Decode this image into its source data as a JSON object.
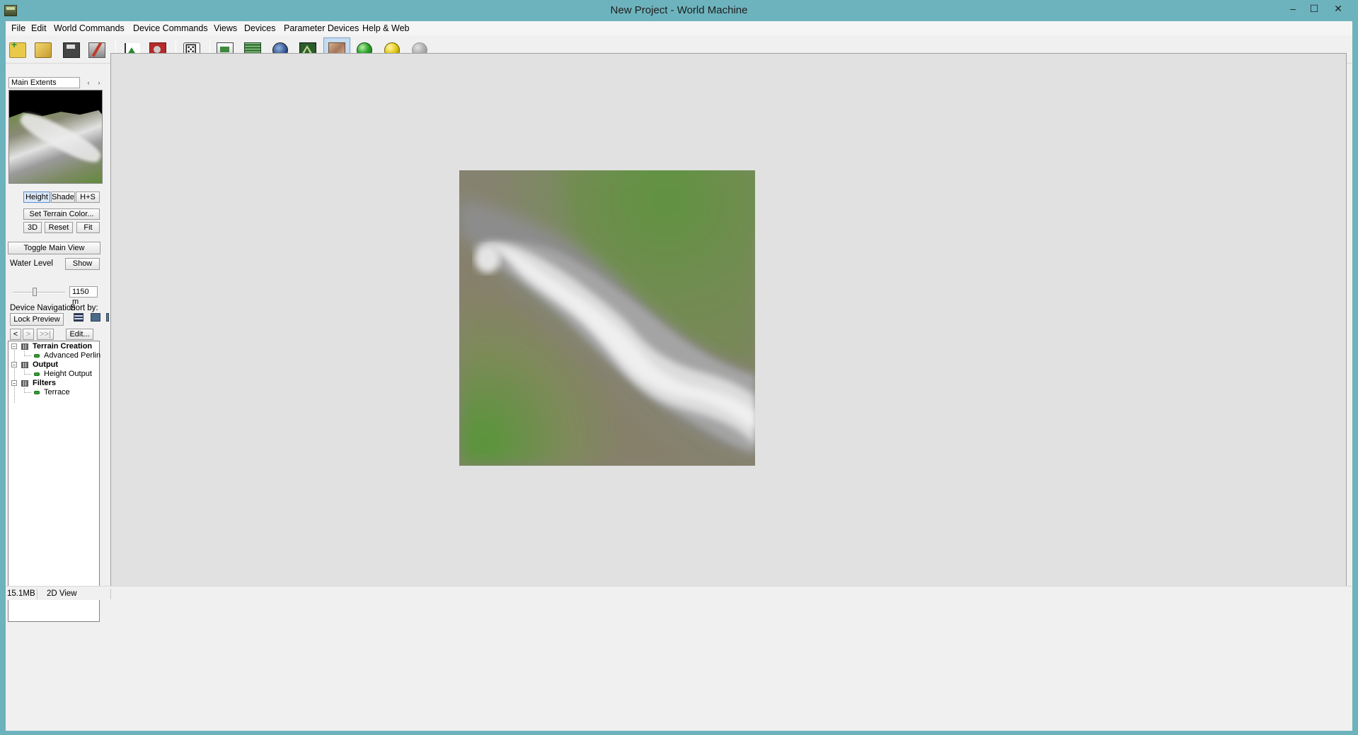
{
  "window": {
    "title": "New Project - World Machine",
    "minimize_glyph": "–",
    "maximize_glyph": "☐",
    "close_glyph": "✕"
  },
  "menubar": {
    "items": [
      "File",
      "Edit",
      "World Commands",
      "Device Commands",
      "Views",
      "Devices",
      "Parameter Devices",
      "Help & Web"
    ]
  },
  "toolbar": {
    "buttons": [
      {
        "icon": "new-project-icon"
      },
      {
        "icon": "open-project-icon"
      },
      {
        "icon": "save-project-icon"
      },
      {
        "icon": "save-as-icon"
      },
      {
        "icon": "device-graph-icon"
      },
      {
        "icon": "help-book-icon"
      },
      {
        "icon": "randomize-dice-icon"
      },
      {
        "icon": "layout-view-icon"
      },
      {
        "icon": "grid-view-icon"
      },
      {
        "icon": "3d-globe-icon"
      },
      {
        "icon": "explorer-mountain-icon"
      },
      {
        "icon": "2d-texture-view-icon",
        "active": true
      },
      {
        "icon": "build-green-icon"
      },
      {
        "icon": "build-yellow-icon"
      },
      {
        "icon": "stop-grey-icon"
      }
    ]
  },
  "left_panel": {
    "extents_label": "Main Extents",
    "prev_arrow": "‹",
    "next_arrow": "›",
    "view_modes": {
      "height": "Height",
      "shade": "Shade",
      "hs": "H+S",
      "selected": "Height"
    },
    "set_terrain_color": "Set Terrain Color...",
    "btn_3d": "3D",
    "btn_reset": "Reset",
    "btn_fit": "Fit",
    "toggle_main_view": "Toggle Main View",
    "water_level_label": "Water Level",
    "water_show": "Show",
    "water_value": "1150 m",
    "device_nav_label": "Device Navigation",
    "sort_by_label": "Sort by:",
    "lock_preview": "Lock Preview",
    "nav_back": "<",
    "nav_fwd": ">",
    "nav_end": ">>|",
    "edit_btn": "Edit...",
    "tree": [
      {
        "group": "Terrain Creation",
        "children": [
          "Advanced Perlin"
        ]
      },
      {
        "group": "Output",
        "children": [
          "Height Output"
        ]
      },
      {
        "group": "Filters",
        "children": [
          "Terrace"
        ]
      }
    ]
  },
  "status_bar": {
    "memory": "15.1MB",
    "view_mode": "2D View"
  },
  "colors": {
    "titlebar": "#6db3bd",
    "workspace": "#e1e1e1",
    "terrain_green": "#5a8e3a",
    "terrain_grey": "#888888",
    "terrain_white": "#e8e8e8"
  }
}
